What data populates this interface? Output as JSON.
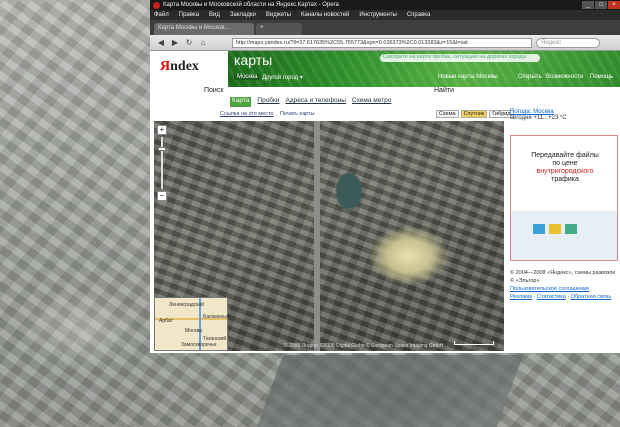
{
  "window": {
    "title": "Карта Москвы и Московской области на Яндекс.Картах - Opera",
    "controls": [
      "_",
      "□",
      "×"
    ]
  },
  "menu": [
    "Файл",
    "Правка",
    "Вид",
    "Закладки",
    "Виджеты",
    "Каналы новостей",
    "Инструменты",
    "Справка"
  ],
  "tabs": [
    {
      "label": "Карта Москвы и Москов..."
    },
    {
      "label": "+"
    }
  ],
  "addressbar": {
    "url": "http://maps.yandex.ru/?ll=37.617635%2C55.755773&spn=0.036373%2C0.013283&z=15&l=sat",
    "search_placeholder": "Яндекс",
    "back": "◀",
    "forward": "▶",
    "reload": "↻",
    "home": "⌂"
  },
  "header": {
    "logo_y": "Я",
    "logo_rest": "ndex",
    "section": "карты",
    "promo": "Смотрите на карте пробки, ситуацию на дорогах города",
    "city_chip": "Москва",
    "city_change": "Другой город ▾",
    "links": [
      "Новые карты Москвы",
      "Открыть",
      "Возможности",
      "Помощь"
    ]
  },
  "searchrow": {
    "label": "Поиск",
    "button": "Найти"
  },
  "context_tabs": [
    "Карта",
    "Пробки",
    "Адреса и телефоны",
    "Схема метро"
  ],
  "toolbar": {
    "link": "Ссылка на это место",
    "print": "Печать карты",
    "map_types": [
      "Схема",
      "Спутник",
      "Гибрид"
    ],
    "selected_type": "Спутник"
  },
  "map": {
    "zoom_in": "+",
    "zoom_out": "−",
    "copyright": "© 2008 Яндекс  ©2006 Digital Globe  © European Space Imaging GmbH",
    "scale_label": "200 м",
    "minimap_labels": [
      "Ленинградский",
      "Москва",
      "Арбат",
      "Басманный",
      "Замоскворечье",
      "Таганский"
    ]
  },
  "weather": {
    "city": "Погода: Москва",
    "temp": "сегодня +11...+23 °C"
  },
  "ad": {
    "line1": "Передавайте файлы",
    "line2": "по цене",
    "line3_red": "внутригородского",
    "line4": "трафика"
  },
  "footer": {
    "copyright": "© 2004—2008 «Яндекс», схемы развязок",
    "credit": "© «Эльгор»",
    "links": [
      "Пользовательское соглашение",
      "Реклама",
      "Статистика",
      "Обратная связь"
    ]
  },
  "colors": {
    "yandex_red": "#e00000",
    "green_band": "#2f8f2b",
    "active_tab": "#4ca23c"
  }
}
